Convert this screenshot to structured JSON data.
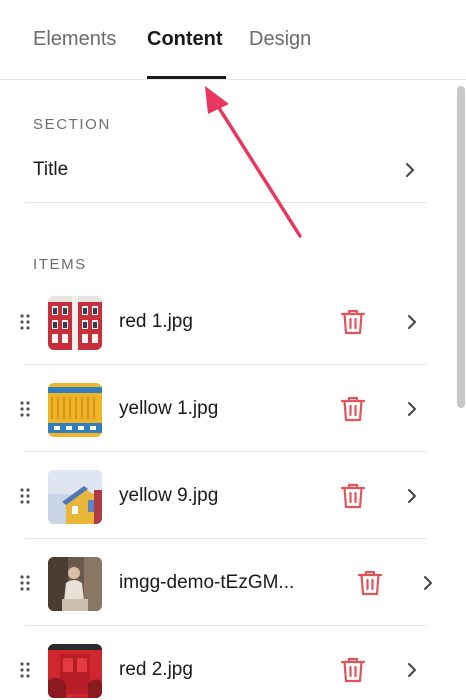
{
  "tabs": [
    {
      "label": "Elements",
      "active": false
    },
    {
      "label": "Content",
      "active": true
    },
    {
      "label": "Design",
      "active": false
    }
  ],
  "section": {
    "heading": "SECTION",
    "title_row_label": "Title"
  },
  "items": {
    "heading": "ITEMS",
    "list": [
      {
        "name": "red 1.jpg",
        "thumb": "red-building"
      },
      {
        "name": "yellow 1.jpg",
        "thumb": "yellow-containers"
      },
      {
        "name": "yellow 9.jpg",
        "thumb": "yellow-house"
      },
      {
        "name": "imgg-demo-tEzGM...",
        "thumb": "person-sitting"
      },
      {
        "name": "red 2.jpg",
        "thumb": "red-door"
      }
    ]
  },
  "colors": {
    "accent_arrow": "#e8365f",
    "trash": "#e0555a",
    "active_tab": "#1a1a1a",
    "inactive_tab": "#6b6b6b"
  },
  "icons": {
    "chevron": "chevron-right-icon",
    "trash": "trash-icon",
    "grip": "drag-handle-icon"
  }
}
